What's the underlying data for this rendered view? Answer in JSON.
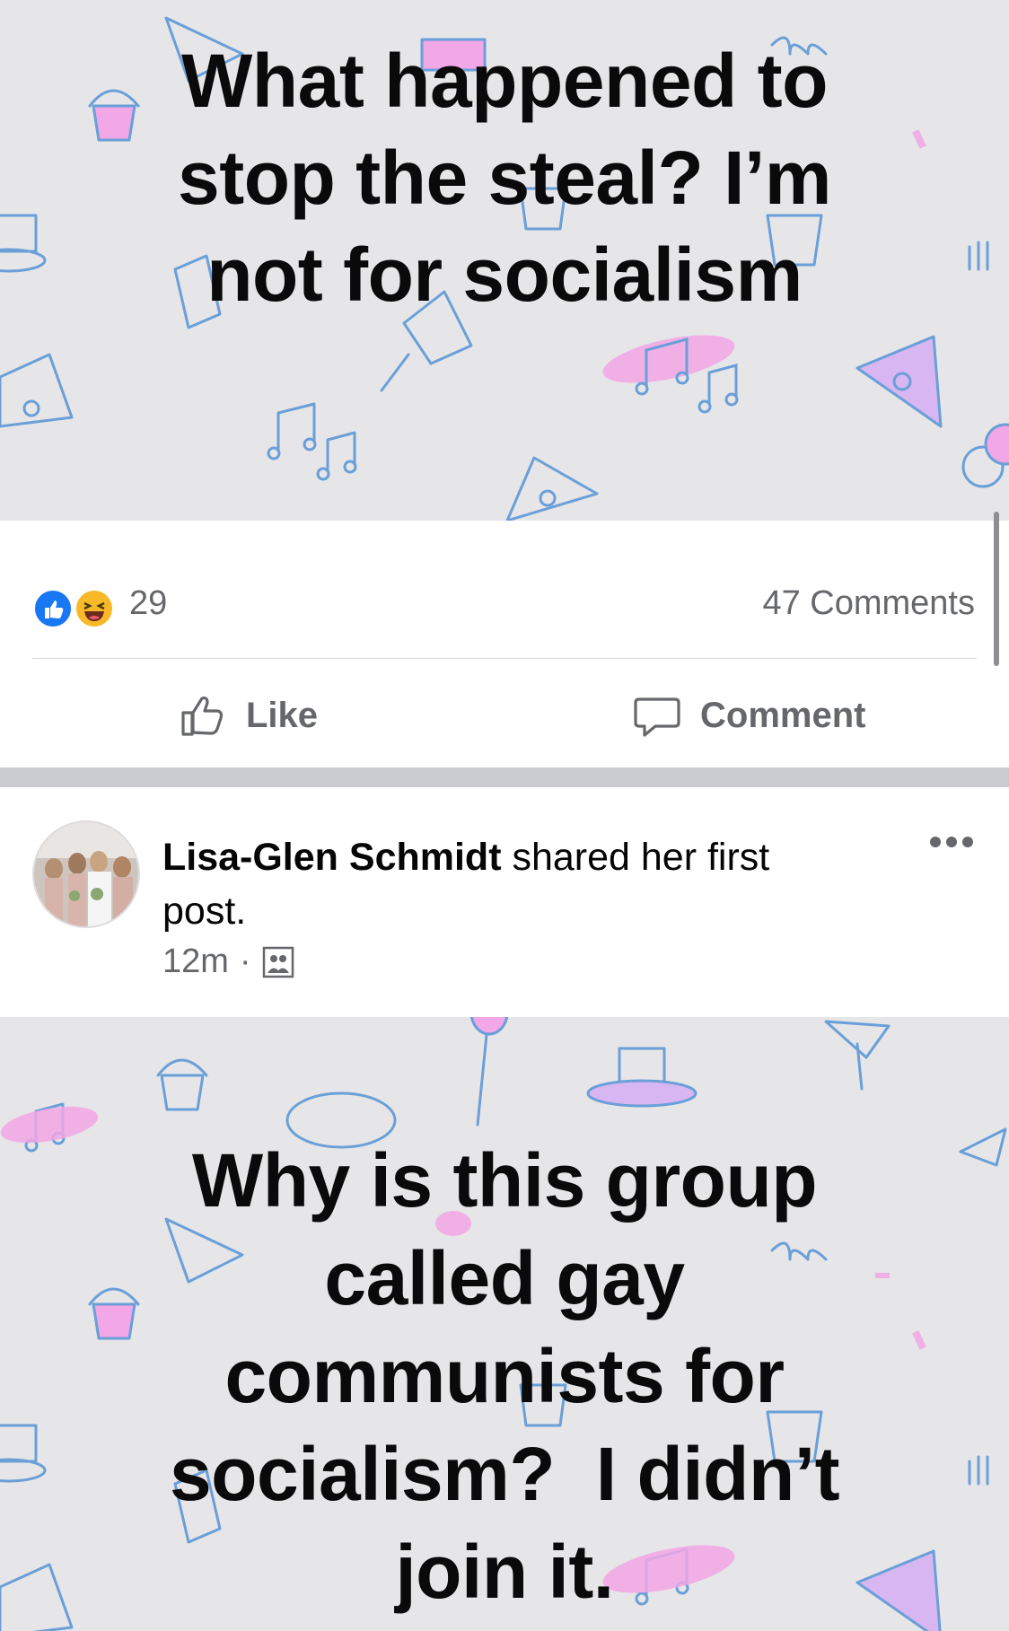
{
  "post1": {
    "text_lines": [
      "What happened to",
      "stop the steal? I’m",
      "not for socialism"
    ],
    "reactions": {
      "icons": [
        "like-icon",
        "haha-icon"
      ],
      "count": "29",
      "comments": "47 Comments"
    },
    "actions": {
      "like_label": "Like",
      "comment_label": "Comment"
    }
  },
  "post2": {
    "author": "Lisa-Glen Schmidt",
    "header_suffix": " shared her first post.",
    "time": "12m",
    "separator": "·",
    "audience_icon": "group-icon",
    "text_lines": [
      "Why is this group",
      "called gay",
      "communists for",
      "socialism?  I didn’t",
      "join it."
    ]
  },
  "colors": {
    "pattern_bg": "#e6e6e8",
    "doodle_blue": "#6a9fd8",
    "doodle_pink": "#f2a7e6",
    "like_blue": "#1877f2",
    "haha_yellow": "#f7b928",
    "secondary_text": "#65676b"
  }
}
